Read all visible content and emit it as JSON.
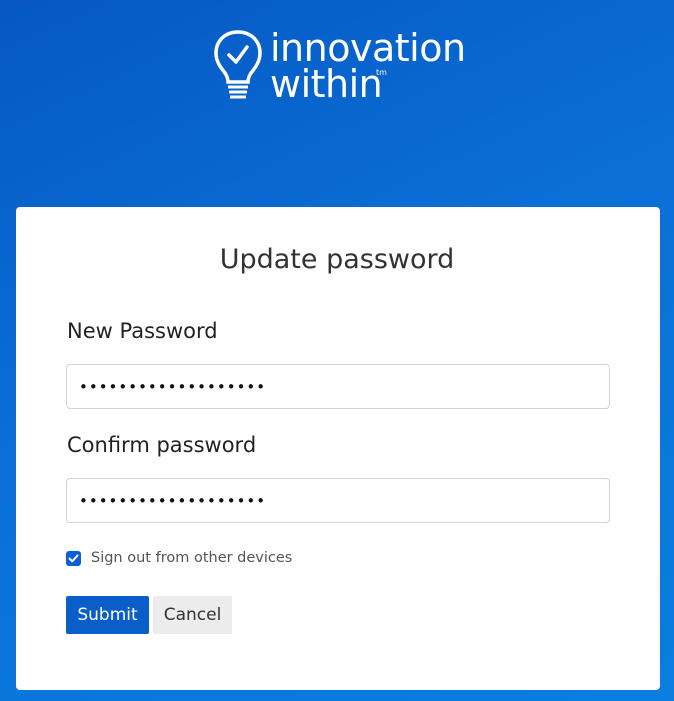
{
  "logo": {
    "line1": "innovation",
    "line2": "within",
    "tm": "tm",
    "icon": "lightbulb-check-icon"
  },
  "form": {
    "title": "Update password",
    "new_password": {
      "label": "New Password",
      "value": "•••••••••••••••••••"
    },
    "confirm_password": {
      "label": "Confirm password",
      "value": "•••••••••••••••••••"
    },
    "signout_checkbox": {
      "label": "Sign out from other devices",
      "checked": true
    },
    "submit_label": "Submit",
    "cancel_label": "Cancel"
  },
  "colors": {
    "background": "#0a6fd6",
    "primary_button": "#0a5ec9",
    "card": "#ffffff"
  }
}
